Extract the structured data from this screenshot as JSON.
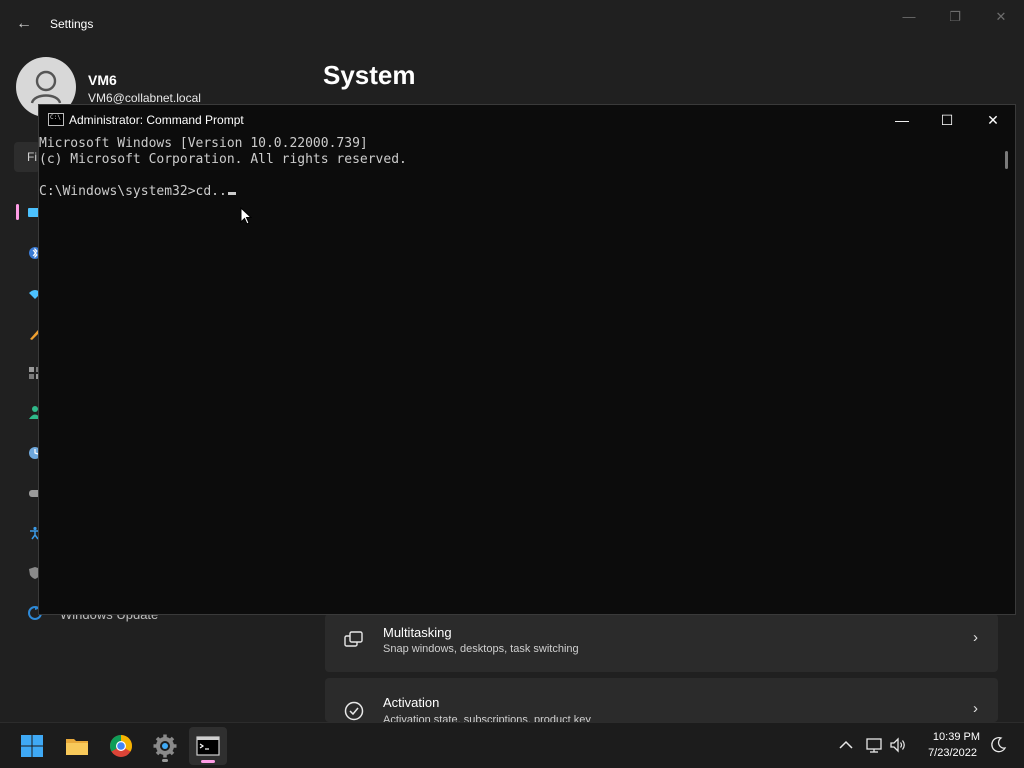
{
  "settings": {
    "window_title": "Settings",
    "user": {
      "name": "VM6",
      "email": "VM6@collabnet.local"
    },
    "page_title": "System",
    "search_fragment": "Fi",
    "nav_partial_label": "Windows Update",
    "nav_icons": [
      "system-icon",
      "bluetooth-icon",
      "network-icon",
      "personalization-icon",
      "apps-icon",
      "accounts-icon",
      "time-language-icon",
      "gaming-icon",
      "accessibility-icon",
      "privacy-icon",
      "windows-update-icon"
    ],
    "cards": [
      {
        "title": "Multitasking",
        "subtitle": "Snap windows, desktops, task switching",
        "icon": "multitasking-icon"
      },
      {
        "title": "Activation",
        "subtitle": "Activation state, subscriptions, product key",
        "icon": "activation-icon"
      }
    ],
    "accent_color": "#ff9de6"
  },
  "cmd": {
    "title": "Administrator: Command Prompt",
    "lines": [
      "Microsoft Windows [Version 10.0.22000.739]",
      "(c) Microsoft Corporation. All rights reserved.",
      "",
      "C:\\Windows\\system32>cd.."
    ],
    "background": "#0c0c0c",
    "text_color": "#cccccc"
  },
  "taskbar": {
    "apps": [
      "start-icon",
      "file-explorer-icon",
      "chrome-icon",
      "settings-icon",
      "command-prompt-icon"
    ],
    "tray_icons": [
      "chevron-up-icon",
      "network-icon",
      "volume-icon"
    ],
    "time": "10:39 PM",
    "date": "7/23/2022"
  }
}
